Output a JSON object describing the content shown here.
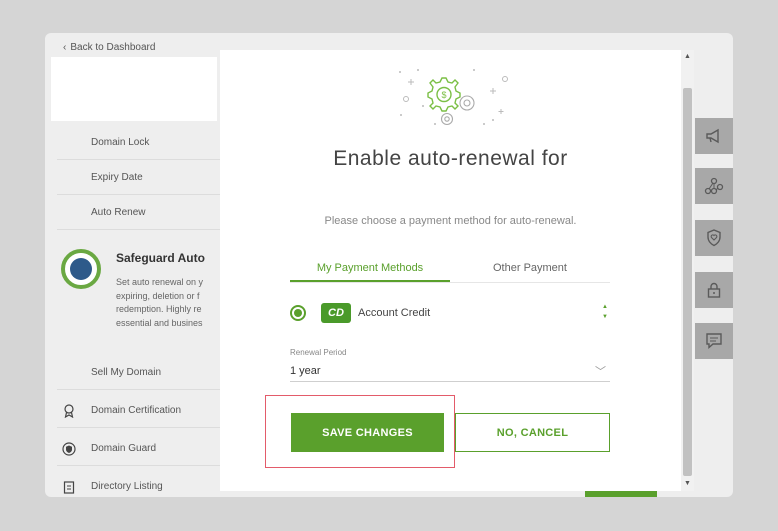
{
  "background": {
    "back_link": "Back to Dashboard",
    "sidebar": {
      "items": [
        {
          "label": "Domain Lock"
        },
        {
          "label": "Expiry Date"
        },
        {
          "label": "Auto Renew"
        }
      ],
      "promo": {
        "title": "Safeguard Auto",
        "text": "Set auto renewal on y\nexpiring, deletion or f\nredemption. Highly re\nessential and busines"
      },
      "items_lower": [
        {
          "label": "Sell My Domain",
          "icon": ""
        },
        {
          "label": "Domain Certification",
          "icon": "certificate-icon"
        },
        {
          "label": "Domain Guard",
          "icon": "shield-icon"
        },
        {
          "label": "Directory Listing",
          "icon": "clipboard-icon"
        }
      ]
    },
    "right_rail_icons": [
      "megaphone-icon",
      "network-icon",
      "shield-heart-icon",
      "lock-icon",
      "chat-icon"
    ]
  },
  "modal": {
    "title": "Enable auto-renewal for",
    "subtitle": "Please choose a payment method for auto-renewal.",
    "tabs": [
      {
        "label": "My Payment Methods",
        "active": true
      },
      {
        "label": "Other Payment",
        "active": false
      }
    ],
    "payment_method": {
      "badge": "CD",
      "label": "Account Credit",
      "selected": true
    },
    "renewal_period": {
      "label": "Renewal Period",
      "value": "1 year"
    },
    "buttons": {
      "save": "SAVE CHANGES",
      "cancel": "NO, CANCEL"
    }
  },
  "colors": {
    "accent": "#5aa02c",
    "highlight_border": "#e35b6a",
    "overlay_panel": "#eeeeee"
  }
}
